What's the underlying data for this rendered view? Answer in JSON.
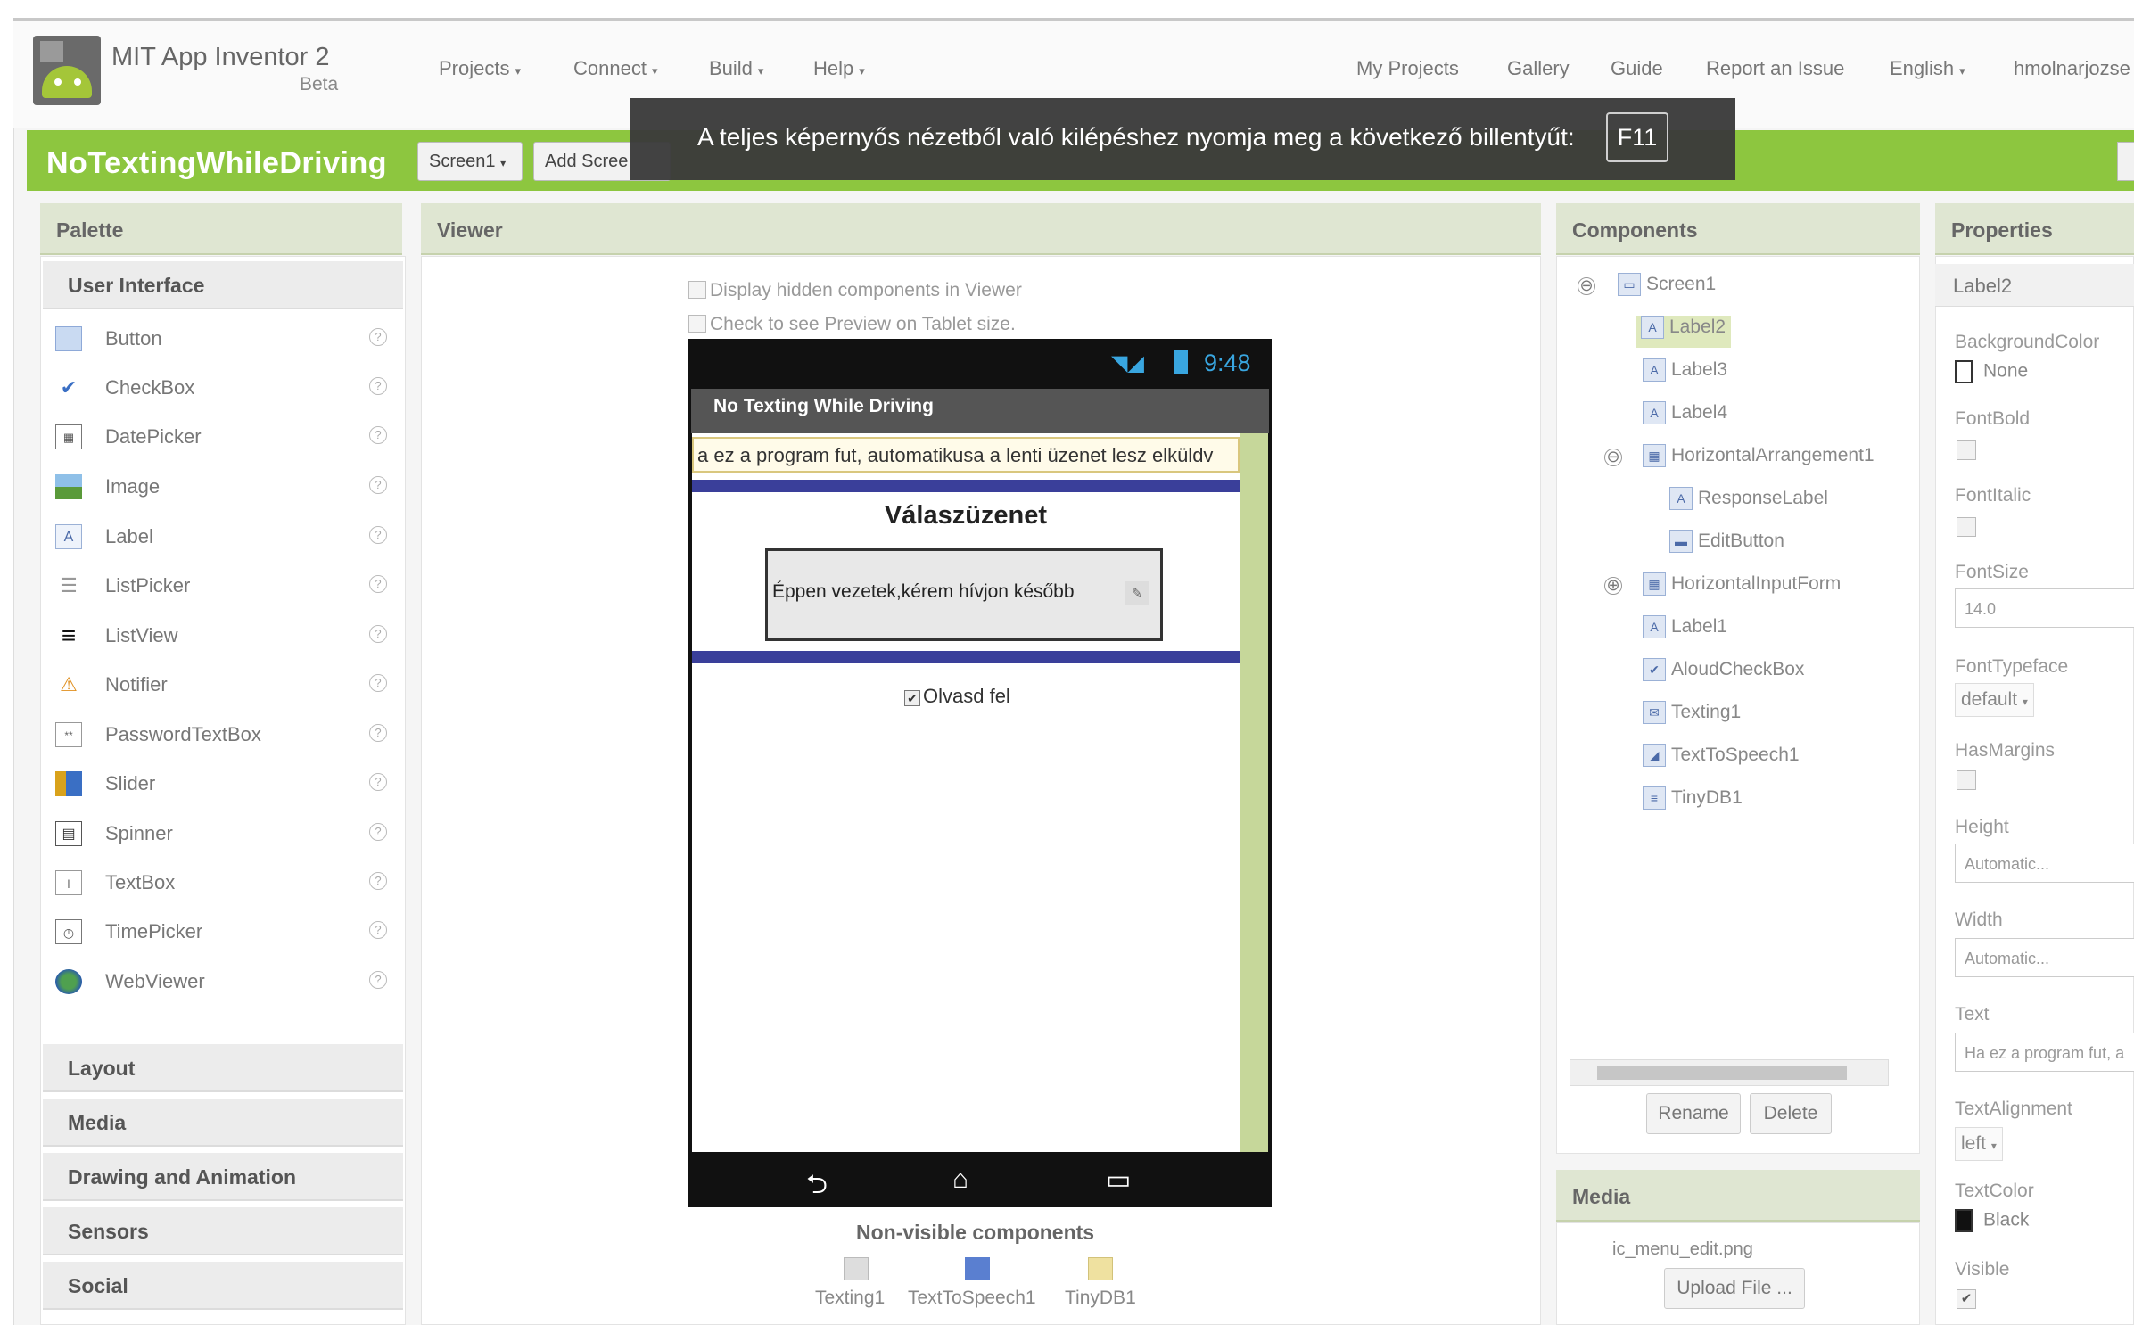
{
  "app": {
    "title": "MIT App Inventor 2",
    "beta": "Beta"
  },
  "menu": [
    {
      "label": "Projects"
    },
    {
      "label": "Connect"
    },
    {
      "label": "Build"
    },
    {
      "label": "Help"
    }
  ],
  "nav": {
    "my_projects": "My Projects",
    "gallery": "Gallery",
    "guide": "Guide",
    "report": "Report an Issue",
    "language": "English",
    "user": "hmolnarjozse"
  },
  "project": {
    "name": "NoTextingWhileDriving",
    "screen_select": "Screen1",
    "add_screen": "Add Scree"
  },
  "toast": {
    "text": "A teljes képernyős nézetből való kilépéshez nyomja meg a következő billentyűt:",
    "key": "F11"
  },
  "palette": {
    "title": "Palette",
    "section_ui": "User Interface",
    "items": [
      {
        "label": "Button",
        "icon": "button-icon"
      },
      {
        "label": "CheckBox",
        "icon": "checkbox-icon"
      },
      {
        "label": "DatePicker",
        "icon": "datepicker-icon"
      },
      {
        "label": "Image",
        "icon": "image-icon"
      },
      {
        "label": "Label",
        "icon": "label-icon"
      },
      {
        "label": "ListPicker",
        "icon": "listpicker-icon"
      },
      {
        "label": "ListView",
        "icon": "listview-icon"
      },
      {
        "label": "Notifier",
        "icon": "notifier-icon"
      },
      {
        "label": "PasswordTextBox",
        "icon": "password-icon"
      },
      {
        "label": "Slider",
        "icon": "slider-icon"
      },
      {
        "label": "Spinner",
        "icon": "spinner-icon"
      },
      {
        "label": "TextBox",
        "icon": "textbox-icon"
      },
      {
        "label": "TimePicker",
        "icon": "timepicker-icon"
      },
      {
        "label": "WebViewer",
        "icon": "webviewer-icon"
      }
    ],
    "help_glyph": "?",
    "sections": [
      "Layout",
      "Media",
      "Drawing and Animation",
      "Sensors",
      "Social"
    ]
  },
  "viewer": {
    "title": "Viewer",
    "display_hidden": "Display hidden components in Viewer",
    "tablet_preview": "Check to see Preview on Tablet size.",
    "phone": {
      "time": "9:48",
      "app_title": "No Texting While Driving",
      "label2_text": "a ez a program fut, automatikusa a lenti üzenet lesz elküldv",
      "response_title": "Válaszüzenet",
      "edit_button_text": "Éppen vezetek,kérem hívjon később",
      "checkbox_label": "Olvasd fel",
      "checkbox_mark": "✔"
    },
    "nonvisible_title": "Non-visible components",
    "nonvisible": [
      "Texting1",
      "TextToSpeech1",
      "TinyDB1"
    ]
  },
  "components": {
    "title": "Components",
    "tree": [
      {
        "label": "Screen1",
        "icon": "screen-icon",
        "glyph": "▭"
      },
      {
        "label": "Label2",
        "icon": "label-icon",
        "glyph": "A",
        "selected": true
      },
      {
        "label": "Label3",
        "icon": "label-icon",
        "glyph": "A"
      },
      {
        "label": "Label4",
        "icon": "label-icon",
        "glyph": "A"
      },
      {
        "label": "HorizontalArrangement1",
        "icon": "arrangement-icon",
        "glyph": "▦"
      },
      {
        "label": "ResponseLabel",
        "icon": "label-icon",
        "glyph": "A"
      },
      {
        "label": "EditButton",
        "icon": "button-icon",
        "glyph": "▬"
      },
      {
        "label": "HorizontalInputForm",
        "icon": "arrangement-icon",
        "glyph": "▦"
      },
      {
        "label": "Label1",
        "icon": "label-icon",
        "glyph": "A"
      },
      {
        "label": "AloudCheckBox",
        "icon": "checkbox-icon",
        "glyph": "✔"
      },
      {
        "label": "Texting1",
        "icon": "texting-icon",
        "glyph": "✉"
      },
      {
        "label": "TextToSpeech1",
        "icon": "speech-icon",
        "glyph": "◢"
      },
      {
        "label": "TinyDB1",
        "icon": "database-icon",
        "glyph": "≡"
      }
    ],
    "collapse": "⊖",
    "expand": "⊕",
    "rename": "Rename",
    "delete": "Delete"
  },
  "media": {
    "title": "Media",
    "file": "ic_menu_edit.png",
    "upload": "Upload File ..."
  },
  "properties": {
    "title": "Properties",
    "component": "Label2",
    "background_color_label": "BackgroundColor",
    "background_color_value": "None",
    "font_bold_label": "FontBold",
    "font_italic_label": "FontItalic",
    "font_size_label": "FontSize",
    "font_size_value": "14.0",
    "font_typeface_label": "FontTypeface",
    "font_typeface_value": "default",
    "has_margins_label": "HasMargins",
    "height_label": "Height",
    "height_value": "Automatic...",
    "width_label": "Width",
    "width_value": "Automatic...",
    "text_label": "Text",
    "text_value": "Ha ez a program fut, a",
    "text_alignment_label": "TextAlignment",
    "text_alignment_value": "left",
    "text_color_label": "TextColor",
    "text_color_value": "Black",
    "visible_label": "Visible",
    "visible_mark": "✔"
  },
  "colors": {
    "accent_green": "#8dc63f",
    "panel_header": "#dfe6d2",
    "selected_row": "#dfe9bd",
    "phone_blue_line": "#3a3f9a",
    "clock_blue": "#39a6e0"
  }
}
